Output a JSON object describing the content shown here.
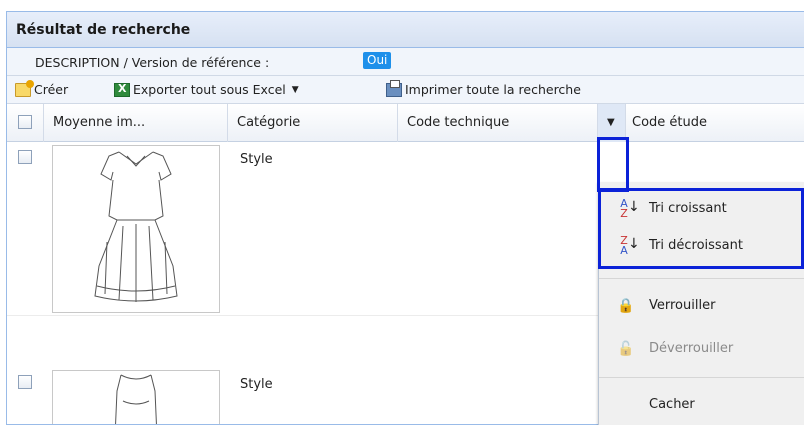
{
  "panel": {
    "title": "Résultat de recherche"
  },
  "description": {
    "text": "DESCRIPTION / Version de référence :",
    "badge": "Oui"
  },
  "toolbar": {
    "create_label": "Créer",
    "export_label": "Exporter tout sous Excel",
    "print_label": "Imprimer toute la recherche"
  },
  "grid": {
    "columns": [
      "Moyenne im...",
      "Catégorie",
      "Code technique",
      "Code étude"
    ],
    "rows": [
      {
        "category": "Style"
      },
      {
        "category": "Style"
      }
    ]
  },
  "context_menu": {
    "sort_asc": "Tri croissant",
    "sort_desc": "Tri décroissant",
    "lock": "Verrouiller",
    "unlock": "Déverrouiller",
    "hide": "Cacher",
    "icons": [
      "sort-az-icon",
      "sort-za-icon",
      "lock-icon",
      "unlock-icon"
    ]
  },
  "colors": {
    "accent": "#1e90ea",
    "highlight": "#0b22d8",
    "header_text": "#1a1a1a"
  }
}
